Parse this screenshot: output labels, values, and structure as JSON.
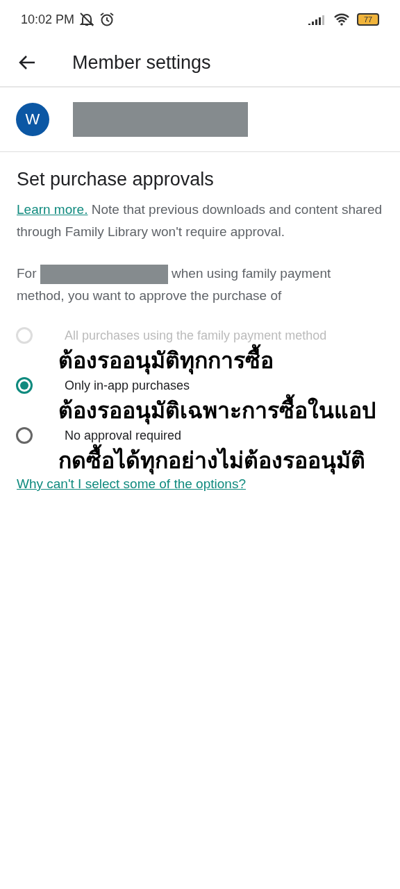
{
  "status_bar": {
    "time": "10:02 PM",
    "battery": "77"
  },
  "app_bar": {
    "title": "Member settings"
  },
  "member": {
    "avatar_letter": "W"
  },
  "section": {
    "title": "Set purchase approvals",
    "learn_more": "Learn more.",
    "note": " Note that previous downloads and content shared through Family Library won't require approval.",
    "prompt_before": "For",
    "prompt_after": "when using family payment",
    "prompt_line2": "method, you want to approve the purchase of"
  },
  "options": [
    {
      "label": "All purchases using the family payment method",
      "selected": false,
      "disabled": true,
      "annotation": "ต้องรออนุมัติทุกการซื้อ"
    },
    {
      "label": "Only in-app purchases",
      "selected": true,
      "disabled": false,
      "annotation": "ต้องรออนุมัติเฉพาะการซื้อในแอป"
    },
    {
      "label": "No approval required",
      "selected": false,
      "disabled": false,
      "annotation": "กดซื้อได้ทุกอย่างไม่ต้องรออนุมัติ"
    }
  ],
  "help_link": "Why can't I select some of the options?"
}
